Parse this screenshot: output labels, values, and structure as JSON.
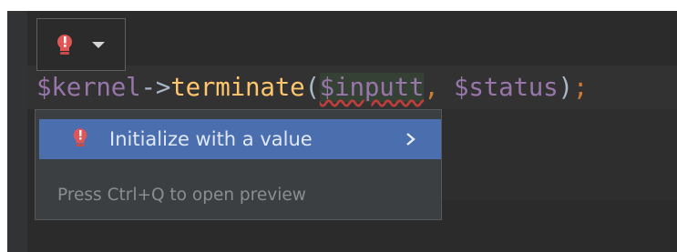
{
  "colors": {
    "editor_bg": "#2b2b2b",
    "popup_bg": "#3c3f41",
    "selection": "#4b6eaf",
    "variable": "#9876aa",
    "function": "#ffc66d",
    "operator": "#a9b7c6",
    "keyword": "#cc7832",
    "error": "#e05555"
  },
  "intention_button": {
    "icon": "red-bulb-icon",
    "dropdown_icon": "chevron-down-icon"
  },
  "code_line": {
    "kernel_var": "$kernel",
    "arrow": "->",
    "function": "terminate",
    "open_paren": "(",
    "arg1": "$inputt",
    "comma": ", ",
    "arg2": "$status",
    "close_paren": ")",
    "semicolon": ";"
  },
  "popup": {
    "items": [
      {
        "label": "Initialize with a value",
        "icon": "red-bulb-icon",
        "submenu_icon": "chevron-right-icon"
      }
    ],
    "hint": "Press Ctrl+Q to open preview"
  }
}
